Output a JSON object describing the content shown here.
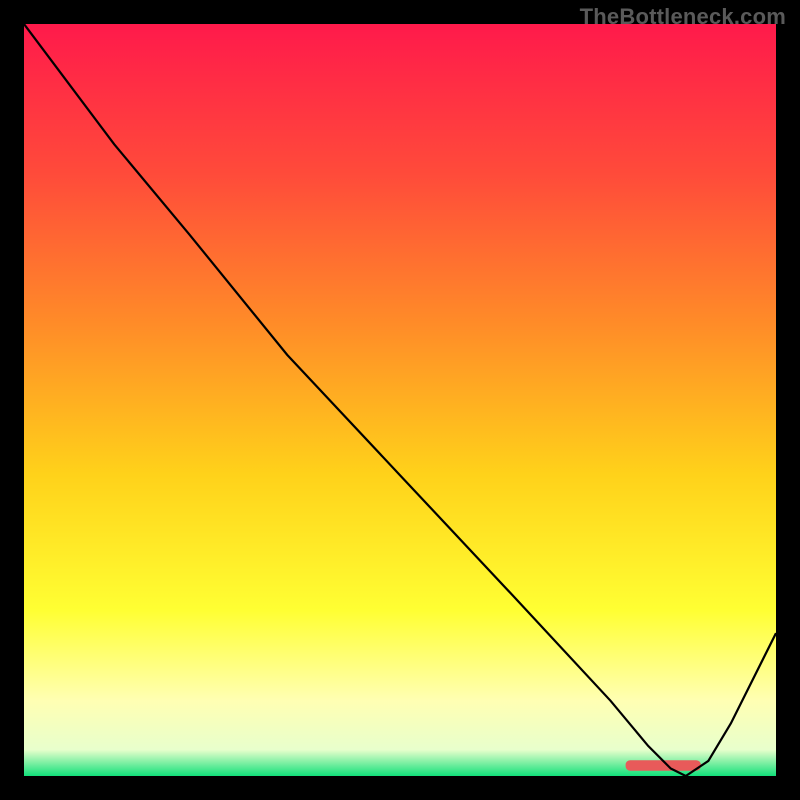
{
  "watermark": "TheBottleneck.com",
  "chart_data": {
    "type": "line",
    "title": "",
    "xlabel": "",
    "ylabel": "",
    "xlim": [
      0,
      100
    ],
    "ylim": [
      0,
      100
    ],
    "grid": false,
    "legend": false,
    "background_gradient_stops": [
      {
        "offset": 0.0,
        "color": "#ff1a4b"
      },
      {
        "offset": 0.2,
        "color": "#ff4b3a"
      },
      {
        "offset": 0.4,
        "color": "#ff8c28"
      },
      {
        "offset": 0.6,
        "color": "#ffd21a"
      },
      {
        "offset": 0.78,
        "color": "#ffff33"
      },
      {
        "offset": 0.9,
        "color": "#ffffb3"
      },
      {
        "offset": 0.965,
        "color": "#e8ffcc"
      },
      {
        "offset": 1.0,
        "color": "#12e07a"
      }
    ],
    "series": [
      {
        "name": "bottleneck-curve",
        "color": "#000000",
        "stroke_width": 2.2,
        "x": [
          0,
          6,
          12,
          22,
          35,
          50,
          65,
          78,
          83,
          86,
          88,
          91,
          94,
          100
        ],
        "y": [
          100,
          92,
          84,
          72,
          56,
          40,
          24,
          10,
          4,
          1,
          0,
          2,
          7,
          19
        ]
      }
    ],
    "marker": {
      "name": "optimal-range",
      "color": "#e85a5a",
      "x_start": 80,
      "x_end": 90,
      "y": 0.7,
      "height": 1.4
    }
  }
}
